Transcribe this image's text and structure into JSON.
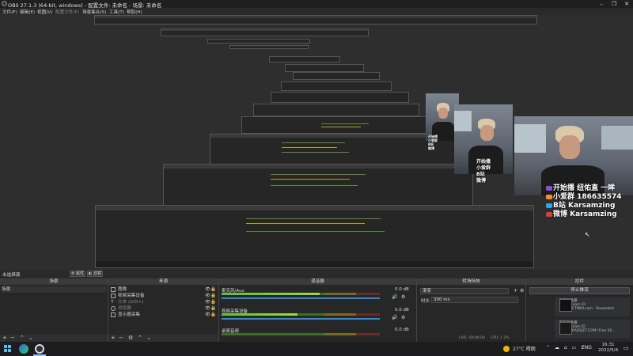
{
  "window": {
    "title": "OBS 27.1.3 (64-bit, windows) - 配置文件: 未命名 - 场景: 未命名",
    "controls": [
      "–",
      "❐",
      "✕"
    ]
  },
  "menu": [
    {
      "label": "文件(F)",
      "enabled": true
    },
    {
      "label": "编辑(E)",
      "enabled": true
    },
    {
      "label": "视图(V)",
      "enabled": true
    },
    {
      "label": "配置文件(P)",
      "enabled": false
    },
    {
      "label": "场景集合(S)",
      "enabled": true
    },
    {
      "label": "工具(T)",
      "enabled": true
    },
    {
      "label": "帮助(H)",
      "enabled": true
    }
  ],
  "overlay": {
    "lines": [
      {
        "text": "开始播 纽佑直 一眸",
        "color": "#f6d04d"
      },
      {
        "text": "小爱群 186635574",
        "color": "#ff9a3c"
      },
      {
        "text": "B站 Karsamzing",
        "color": "#5ec8ff"
      },
      {
        "text": "微博 Karsamzing",
        "color": "#ff5a5a"
      }
    ]
  },
  "scene_bar": {
    "label": "未选择源",
    "properties": "属性",
    "filters": "滤镜"
  },
  "scenes": {
    "header": "场景",
    "items": [
      "场景"
    ]
  },
  "sources": {
    "header": "来源",
    "items": [
      {
        "name": "图像",
        "icon": "image-icon"
      },
      {
        "name": "视频采集设备",
        "icon": "camera-icon"
      },
      {
        "name": "文本 (GDI+)",
        "icon": "text-icon"
      },
      {
        "name": "浏览器",
        "icon": "browser-icon"
      },
      {
        "name": "显示器采集",
        "icon": "monitor-icon"
      }
    ]
  },
  "mixer": {
    "header": "混音器",
    "channels": [
      {
        "name": "麦克风/Aux",
        "db": "0.0 dB",
        "level": 0.62
      },
      {
        "name": "视频采集设备",
        "db": "0.0 dB",
        "level": 0.48
      },
      {
        "name": "桌面音频",
        "db": "0.0 dB",
        "level": 0.0
      }
    ]
  },
  "transitions": {
    "header": "转场特效",
    "type": "渐变",
    "duration_label": "时长",
    "duration_value": "300 ms"
  },
  "controls": {
    "header": "控件",
    "stop_streaming": "停止推流",
    "notifications": [
      {
        "title": "斯巴顿直播",
        "line2": "主人: Steam ID",
        "line3": "CSGOBETWIN.com - Rewarded"
      },
      {
        "title": "斯巴顿直播",
        "line2": "主人: Steam ID",
        "line3": "CSGOTRADEJET.COM (Free Sti..."
      }
    ]
  },
  "statusbar": {
    "live_time": "LIVE: 00:00:00",
    "cpu": "CPU: 1.2%"
  },
  "taskbar": {
    "weather": "27°C 晴朗",
    "lang": "ENG",
    "time": "16:31",
    "date": "2022/5/4"
  },
  "colors": {
    "accent_green": "#5a9a3a",
    "accent_yellow": "#c8a832",
    "accent_red": "#c0392b",
    "meter_blue": "#2e8bd6"
  }
}
